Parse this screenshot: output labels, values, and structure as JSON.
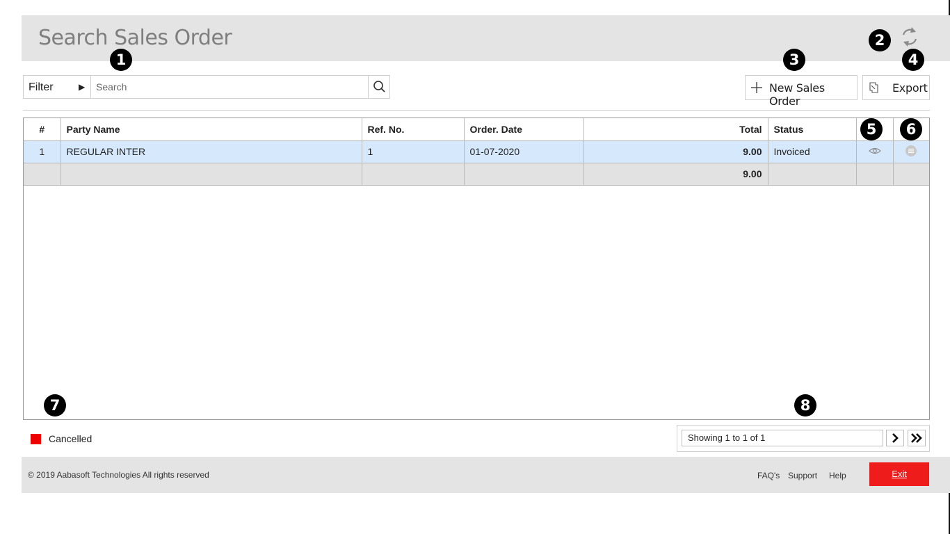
{
  "header": {
    "title": "Search Sales Order"
  },
  "toolbar": {
    "filter_label": "Filter",
    "search_placeholder": "Search",
    "new_button_label": "New Sales Order",
    "export_button_label": "Export"
  },
  "badges": [
    "1",
    "2",
    "3",
    "4",
    "5",
    "6",
    "7",
    "8"
  ],
  "table": {
    "columns": [
      "#",
      "Party Name",
      "Ref. No.",
      "Order. Date",
      "Total",
      "Status",
      "",
      ""
    ],
    "rows": [
      {
        "no": "1",
        "party_name": "REGULAR INTER",
        "ref_no": "1",
        "order_date": "01-07-2020",
        "total": "9.00",
        "status": "Invoiced"
      }
    ],
    "totals": {
      "total": "9.00"
    }
  },
  "legend": {
    "label": "Cancelled",
    "color": "#ee0000"
  },
  "pager": {
    "text": "Showing 1 to 1 of 1"
  },
  "footer": {
    "copyright": "© 2019 Aabasoft Technologies All rights reserved",
    "links": [
      "FAQ's",
      "Support",
      "Help"
    ],
    "exit_label": "Exit"
  },
  "colors": {
    "exit": "#ef1c1c",
    "selected_row": "#d6e8fb",
    "header_bg": "#e4e4e4"
  },
  "icons": [
    "refresh-icon",
    "search-icon",
    "plus-icon",
    "export-icon",
    "eye-icon",
    "menu-icon",
    "chevron-right-icon",
    "double-chevron-right-icon"
  ]
}
